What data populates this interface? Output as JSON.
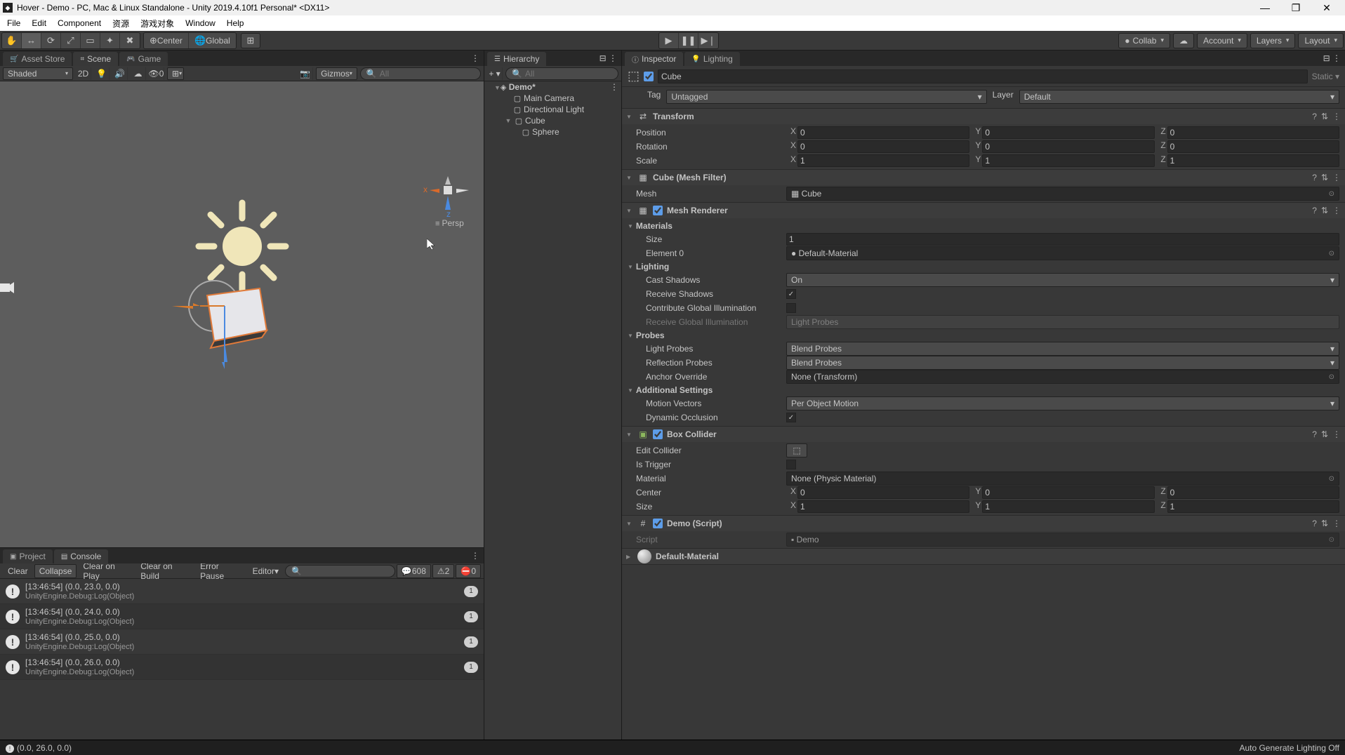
{
  "window": {
    "title": "Hover - Demo - PC, Mac & Linux Standalone - Unity 2019.4.10f1 Personal* <DX11>"
  },
  "menu": [
    "File",
    "Edit",
    "Component",
    "资源",
    "游戏对象",
    "Window",
    "Help"
  ],
  "toolbar": {
    "pivot": "Center",
    "space": "Global",
    "collab": "Collab",
    "account": "Account",
    "layers": "Layers",
    "layout": "Layout"
  },
  "left_tabs": {
    "asset_store": "Asset Store",
    "scene": "Scene",
    "game": "Game"
  },
  "scene_toolbar": {
    "shading": "Shaded",
    "mode2d": "2D",
    "gizmos": "Gizmos",
    "eye_count": "0",
    "search_placeholder": "All"
  },
  "scene_view": {
    "axes": {
      "x": "x",
      "z": "z"
    },
    "projection": "Persp"
  },
  "bottom_tabs": {
    "project": "Project",
    "console": "Console"
  },
  "console": {
    "buttons": {
      "clear": "Clear",
      "collapse": "Collapse",
      "clear_play": "Clear on Play",
      "clear_build": "Clear on Build",
      "error_pause": "Error Pause",
      "editor": "Editor"
    },
    "counts": {
      "info": "608",
      "warn": "2",
      "error": "0"
    },
    "logs": [
      {
        "line1": "[13:46:54] (0.0, 23.0, 0.0)",
        "line2": "UnityEngine.Debug:Log(Object)",
        "count": "1"
      },
      {
        "line1": "[13:46:54] (0.0, 24.0, 0.0)",
        "line2": "UnityEngine.Debug:Log(Object)",
        "count": "1"
      },
      {
        "line1": "[13:46:54] (0.0, 25.0, 0.0)",
        "line2": "UnityEngine.Debug:Log(Object)",
        "count": "1"
      },
      {
        "line1": "[13:46:54] (0.0, 26.0, 0.0)",
        "line2": "UnityEngine.Debug:Log(Object)",
        "count": "1"
      }
    ]
  },
  "hierarchy": {
    "tab": "Hierarchy",
    "search_placeholder": "All",
    "scene": "Demo*",
    "items": [
      "Main Camera",
      "Directional Light",
      "Cube",
      "Sphere"
    ]
  },
  "inspector": {
    "tabs": {
      "inspector": "Inspector",
      "lighting": "Lighting"
    },
    "object_name": "Cube",
    "static": "Static",
    "tag_label": "Tag",
    "tag_value": "Untagged",
    "layer_label": "Layer",
    "layer_value": "Default",
    "transform": {
      "title": "Transform",
      "position": "Position",
      "rotation": "Rotation",
      "scale": "Scale",
      "pos": {
        "x": "0",
        "y": "0",
        "z": "0"
      },
      "rot": {
        "x": "0",
        "y": "0",
        "z": "0"
      },
      "scl": {
        "x": "1",
        "y": "1",
        "z": "1"
      }
    },
    "mesh_filter": {
      "title": "Cube (Mesh Filter)",
      "mesh_label": "Mesh",
      "mesh_value": "Cube"
    },
    "mesh_renderer": {
      "title": "Mesh Renderer",
      "materials": "Materials",
      "size_label": "Size",
      "size_value": "1",
      "element0_label": "Element 0",
      "element0_value": "Default-Material",
      "lighting": "Lighting",
      "cast_shadows": "Cast Shadows",
      "cast_shadows_value": "On",
      "receive_shadows": "Receive Shadows",
      "contribute_gi": "Contribute Global Illumination",
      "receive_gi": "Receive Global Illumination",
      "receive_gi_value": "Light Probes",
      "probes": "Probes",
      "light_probes": "Light Probes",
      "light_probes_value": "Blend Probes",
      "reflection_probes": "Reflection Probes",
      "reflection_probes_value": "Blend Probes",
      "anchor_override": "Anchor Override",
      "anchor_override_value": "None (Transform)",
      "additional": "Additional Settings",
      "motion_vectors": "Motion Vectors",
      "motion_vectors_value": "Per Object Motion",
      "dynamic_occlusion": "Dynamic Occlusion"
    },
    "box_collider": {
      "title": "Box Collider",
      "edit_collider": "Edit Collider",
      "is_trigger": "Is Trigger",
      "material": "Material",
      "material_value": "None (Physic Material)",
      "center": "Center",
      "center_v": {
        "x": "0",
        "y": "0",
        "z": "0"
      },
      "size": "Size",
      "size_v": {
        "x": "1",
        "y": "1",
        "z": "1"
      }
    },
    "script": {
      "title": "Demo (Script)",
      "script_label": "Script",
      "script_value": "Demo"
    },
    "material": {
      "title": "Default-Material"
    }
  },
  "statusbar": {
    "left": "(0.0, 26.0, 0.0)",
    "right": "Auto Generate Lighting Off"
  }
}
